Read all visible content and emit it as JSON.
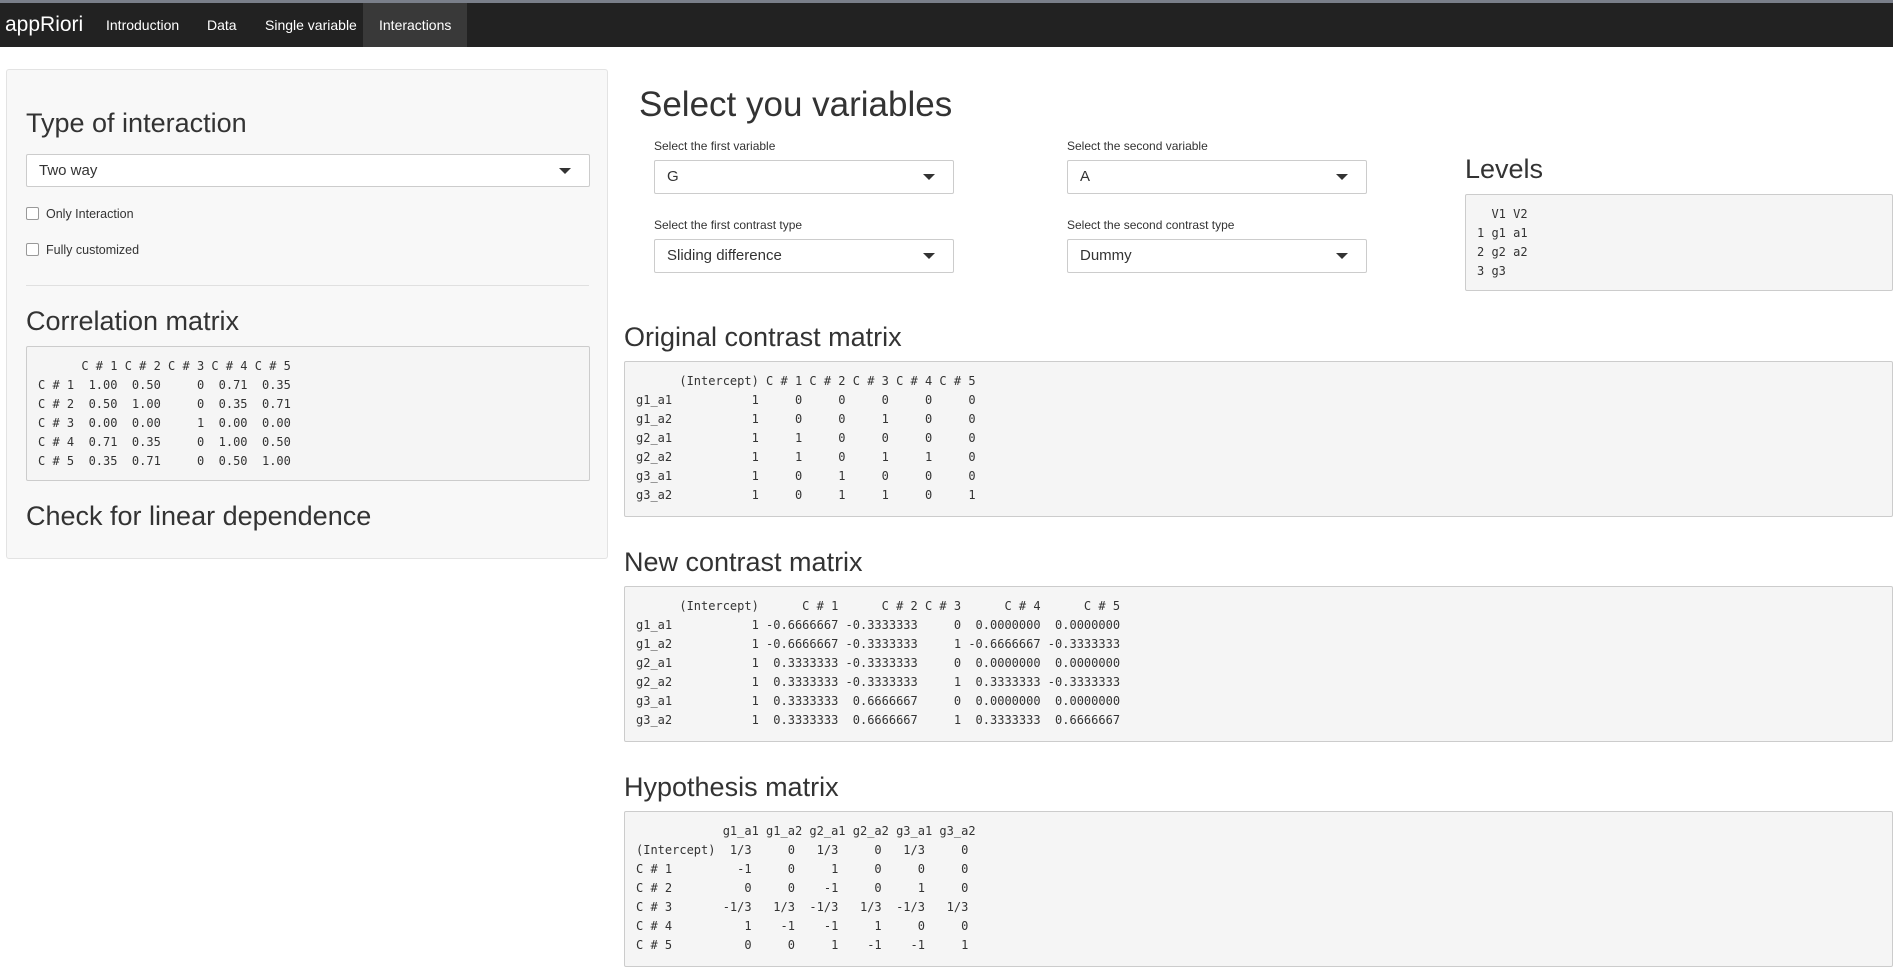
{
  "navbar": {
    "brand": "appRiori",
    "items": [
      {
        "label": "Introduction"
      },
      {
        "label": "Data"
      },
      {
        "label": "Single variable"
      },
      {
        "label": "Interactions"
      }
    ]
  },
  "sidebar": {
    "type_heading": "Type of interaction",
    "type_select": "Two way",
    "only_interaction_label": "Only Interaction",
    "fully_customized_label": "Fully customized",
    "correlation_heading": "Correlation matrix",
    "correlation_output": "      C # 1 C # 2 C # 3 C # 4 C # 5\nC # 1  1.00  0.50     0  0.71  0.35\nC # 2  0.50  1.00     0  0.35  0.71\nC # 3  0.00  0.00     1  0.00  0.00\nC # 4  0.71  0.35     0  1.00  0.50\nC # 5  0.35  0.71     0  0.50  1.00",
    "linear_dependence_heading": "Check for linear dependence"
  },
  "main": {
    "title": "Select you variables",
    "first_variable_label": "Select the first variable",
    "first_variable_value": "G",
    "second_variable_label": "Select the second variable",
    "second_variable_value": "A",
    "first_contrast_label": "Select the first contrast type",
    "first_contrast_value": "Sliding difference",
    "second_contrast_label": "Select the second contrast type",
    "second_contrast_value": "Dummy",
    "levels_heading": "Levels",
    "levels_output": "  V1 V2\n1 g1 a1\n2 g2 a2\n3 g3",
    "original_heading": "Original contrast matrix",
    "original_output": "      (Intercept) C # 1 C # 2 C # 3 C # 4 C # 5\ng1_a1           1     0     0     0     0     0\ng1_a2           1     0     0     1     0     0\ng2_a1           1     1     0     0     0     0\ng2_a2           1     1     0     1     1     0\ng3_a1           1     0     1     0     0     0\ng3_a2           1     0     1     1     0     1",
    "new_heading": "New contrast matrix",
    "new_output": "      (Intercept)      C # 1      C # 2 C # 3      C # 4      C # 5\ng1_a1           1 -0.6666667 -0.3333333     0  0.0000000  0.0000000\ng1_a2           1 -0.6666667 -0.3333333     1 -0.6666667 -0.3333333\ng2_a1           1  0.3333333 -0.3333333     0  0.0000000  0.0000000\ng2_a2           1  0.3333333 -0.3333333     1  0.3333333 -0.3333333\ng3_a1           1  0.3333333  0.6666667     0  0.0000000  0.0000000\ng3_a2           1  0.3333333  0.6666667     1  0.3333333  0.6666667",
    "hypothesis_heading": "Hypothesis matrix",
    "hypothesis_output": "            g1_a1 g1_a2 g2_a1 g2_a2 g3_a1 g3_a2\n(Intercept)  1/3     0   1/3     0   1/3     0\nC # 1         -1     0     1     0     0     0\nC # 2          0     0    -1     0     1     0\nC # 3       -1/3   1/3  -1/3   1/3  -1/3   1/3\nC # 4          1    -1    -1     1     0     0\nC # 5          0     0     1    -1    -1     1"
  }
}
